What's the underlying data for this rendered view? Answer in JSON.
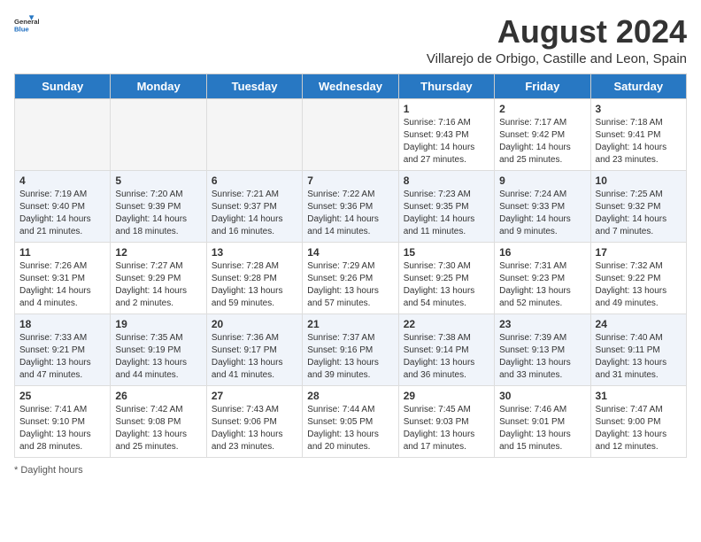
{
  "header": {
    "logo_general": "General",
    "logo_blue": "Blue",
    "main_title": "August 2024",
    "subtitle": "Villarejo de Orbigo, Castille and Leon, Spain"
  },
  "calendar": {
    "days_of_week": [
      "Sunday",
      "Monday",
      "Tuesday",
      "Wednesday",
      "Thursday",
      "Friday",
      "Saturday"
    ],
    "weeks": [
      [
        {
          "day": "",
          "info": ""
        },
        {
          "day": "",
          "info": ""
        },
        {
          "day": "",
          "info": ""
        },
        {
          "day": "",
          "info": ""
        },
        {
          "day": "1",
          "info": "Sunrise: 7:16 AM\nSunset: 9:43 PM\nDaylight: 14 hours and 27 minutes."
        },
        {
          "day": "2",
          "info": "Sunrise: 7:17 AM\nSunset: 9:42 PM\nDaylight: 14 hours and 25 minutes."
        },
        {
          "day": "3",
          "info": "Sunrise: 7:18 AM\nSunset: 9:41 PM\nDaylight: 14 hours and 23 minutes."
        }
      ],
      [
        {
          "day": "4",
          "info": "Sunrise: 7:19 AM\nSunset: 9:40 PM\nDaylight: 14 hours and 21 minutes."
        },
        {
          "day": "5",
          "info": "Sunrise: 7:20 AM\nSunset: 9:39 PM\nDaylight: 14 hours and 18 minutes."
        },
        {
          "day": "6",
          "info": "Sunrise: 7:21 AM\nSunset: 9:37 PM\nDaylight: 14 hours and 16 minutes."
        },
        {
          "day": "7",
          "info": "Sunrise: 7:22 AM\nSunset: 9:36 PM\nDaylight: 14 hours and 14 minutes."
        },
        {
          "day": "8",
          "info": "Sunrise: 7:23 AM\nSunset: 9:35 PM\nDaylight: 14 hours and 11 minutes."
        },
        {
          "day": "9",
          "info": "Sunrise: 7:24 AM\nSunset: 9:33 PM\nDaylight: 14 hours and 9 minutes."
        },
        {
          "day": "10",
          "info": "Sunrise: 7:25 AM\nSunset: 9:32 PM\nDaylight: 14 hours and 7 minutes."
        }
      ],
      [
        {
          "day": "11",
          "info": "Sunrise: 7:26 AM\nSunset: 9:31 PM\nDaylight: 14 hours and 4 minutes."
        },
        {
          "day": "12",
          "info": "Sunrise: 7:27 AM\nSunset: 9:29 PM\nDaylight: 14 hours and 2 minutes."
        },
        {
          "day": "13",
          "info": "Sunrise: 7:28 AM\nSunset: 9:28 PM\nDaylight: 13 hours and 59 minutes."
        },
        {
          "day": "14",
          "info": "Sunrise: 7:29 AM\nSunset: 9:26 PM\nDaylight: 13 hours and 57 minutes."
        },
        {
          "day": "15",
          "info": "Sunrise: 7:30 AM\nSunset: 9:25 PM\nDaylight: 13 hours and 54 minutes."
        },
        {
          "day": "16",
          "info": "Sunrise: 7:31 AM\nSunset: 9:23 PM\nDaylight: 13 hours and 52 minutes."
        },
        {
          "day": "17",
          "info": "Sunrise: 7:32 AM\nSunset: 9:22 PM\nDaylight: 13 hours and 49 minutes."
        }
      ],
      [
        {
          "day": "18",
          "info": "Sunrise: 7:33 AM\nSunset: 9:21 PM\nDaylight: 13 hours and 47 minutes."
        },
        {
          "day": "19",
          "info": "Sunrise: 7:35 AM\nSunset: 9:19 PM\nDaylight: 13 hours and 44 minutes."
        },
        {
          "day": "20",
          "info": "Sunrise: 7:36 AM\nSunset: 9:17 PM\nDaylight: 13 hours and 41 minutes."
        },
        {
          "day": "21",
          "info": "Sunrise: 7:37 AM\nSunset: 9:16 PM\nDaylight: 13 hours and 39 minutes."
        },
        {
          "day": "22",
          "info": "Sunrise: 7:38 AM\nSunset: 9:14 PM\nDaylight: 13 hours and 36 minutes."
        },
        {
          "day": "23",
          "info": "Sunrise: 7:39 AM\nSunset: 9:13 PM\nDaylight: 13 hours and 33 minutes."
        },
        {
          "day": "24",
          "info": "Sunrise: 7:40 AM\nSunset: 9:11 PM\nDaylight: 13 hours and 31 minutes."
        }
      ],
      [
        {
          "day": "25",
          "info": "Sunrise: 7:41 AM\nSunset: 9:10 PM\nDaylight: 13 hours and 28 minutes."
        },
        {
          "day": "26",
          "info": "Sunrise: 7:42 AM\nSunset: 9:08 PM\nDaylight: 13 hours and 25 minutes."
        },
        {
          "day": "27",
          "info": "Sunrise: 7:43 AM\nSunset: 9:06 PM\nDaylight: 13 hours and 23 minutes."
        },
        {
          "day": "28",
          "info": "Sunrise: 7:44 AM\nSunset: 9:05 PM\nDaylight: 13 hours and 20 minutes."
        },
        {
          "day": "29",
          "info": "Sunrise: 7:45 AM\nSunset: 9:03 PM\nDaylight: 13 hours and 17 minutes."
        },
        {
          "day": "30",
          "info": "Sunrise: 7:46 AM\nSunset: 9:01 PM\nDaylight: 13 hours and 15 minutes."
        },
        {
          "day": "31",
          "info": "Sunrise: 7:47 AM\nSunset: 9:00 PM\nDaylight: 13 hours and 12 minutes."
        }
      ]
    ]
  },
  "footer": {
    "note": "Daylight hours"
  }
}
